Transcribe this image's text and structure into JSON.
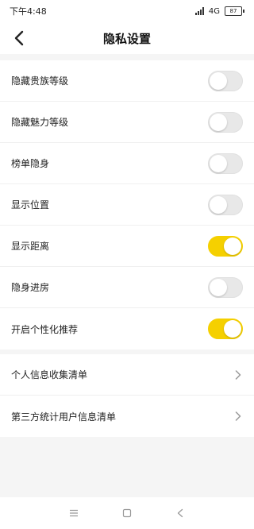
{
  "status_bar": {
    "time": "下午4:48",
    "network": "4G",
    "battery": "87"
  },
  "header": {
    "title": "隐私设置"
  },
  "toggles": [
    {
      "label": "隐藏贵族等级",
      "on": false
    },
    {
      "label": "隐藏魅力等级",
      "on": false
    },
    {
      "label": "榜单隐身",
      "on": false
    },
    {
      "label": "显示位置",
      "on": false
    },
    {
      "label": "显示距离",
      "on": true
    },
    {
      "label": "隐身进房",
      "on": false
    },
    {
      "label": "开启个性化推荐",
      "on": true
    }
  ],
  "links": [
    {
      "label": "个人信息收集清单"
    },
    {
      "label": "第三方统计用户信息清单"
    }
  ],
  "colors": {
    "toggle_on": "#f5d000",
    "toggle_off": "#e8e8e8",
    "page_bg": "#f5f5f5"
  },
  "icons": {
    "back": "chevron-left-icon",
    "link": "chevron-right-icon",
    "nav_menu": "menu-icon",
    "nav_home": "square-icon",
    "nav_back": "triangle-back-icon"
  }
}
